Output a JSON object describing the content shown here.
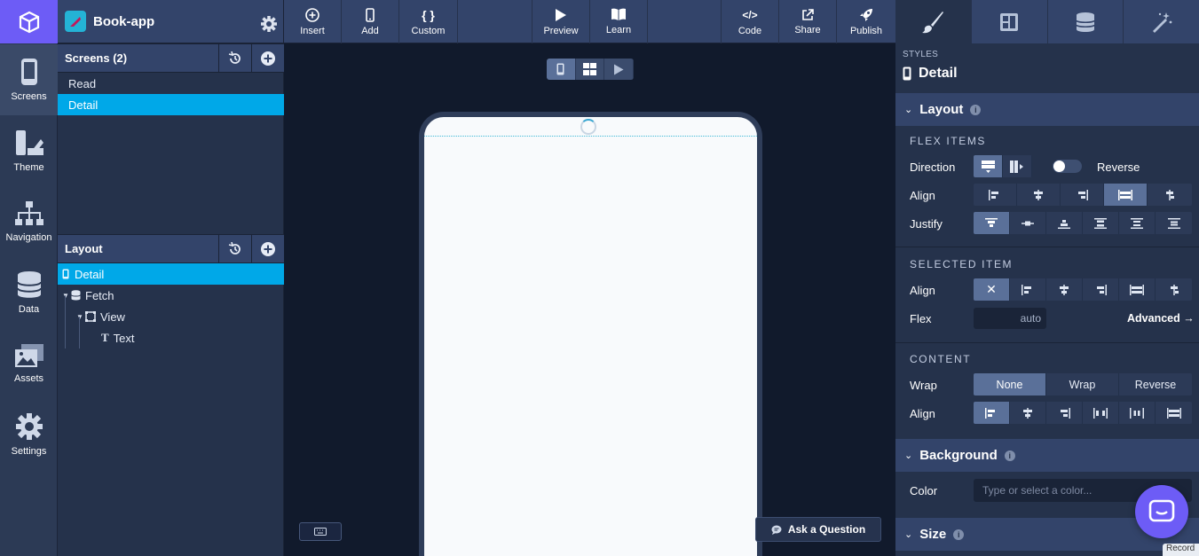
{
  "app": {
    "project_name": "Book-app",
    "brand_color": "#6d5cf6",
    "selection_color": "#00a8e8"
  },
  "rail": {
    "items": [
      {
        "label": "Screens",
        "icon": "phone-icon"
      },
      {
        "label": "Theme",
        "icon": "paint-icon"
      },
      {
        "label": "Navigation",
        "icon": "sitemap-icon"
      },
      {
        "label": "Data",
        "icon": "database-icon"
      },
      {
        "label": "Assets",
        "icon": "images-icon"
      },
      {
        "label": "Settings",
        "icon": "gear-icon"
      }
    ]
  },
  "screens": {
    "title": "Screens (2)",
    "items": [
      "Read",
      "Detail"
    ],
    "selected": "Detail"
  },
  "layout_tree": {
    "title": "Layout",
    "nodes": [
      {
        "label": "Detail",
        "icon": "phone-icon",
        "depth": 0
      },
      {
        "label": "Fetch",
        "icon": "database-icon",
        "depth": 1
      },
      {
        "label": "View",
        "icon": "square-icon",
        "depth": 2
      },
      {
        "label": "Text",
        "icon": "text-icon",
        "depth": 3
      }
    ]
  },
  "toolbar": {
    "insert": "Insert",
    "add": "Add",
    "custom": "Custom",
    "preview": "Preview",
    "learn": "Learn",
    "code": "Code",
    "share": "Share",
    "publish": "Publish"
  },
  "canvas": {
    "ask_label": "Ask a Question"
  },
  "styles": {
    "caption": "STYLES",
    "element": "Detail",
    "layout": {
      "title": "Layout",
      "flex_items": "FLEX ITEMS",
      "direction_label": "Direction",
      "reverse_label": "Reverse",
      "align_label": "Align",
      "justify_label": "Justify"
    },
    "selected_item": {
      "title": "SELECTED ITEM",
      "align_label": "Align",
      "flex_label": "Flex",
      "flex_value": "auto",
      "advanced": "Advanced →"
    },
    "content": {
      "title": "CONTENT",
      "wrap_label": "Wrap",
      "wrap_options": [
        "None",
        "Wrap",
        "Reverse"
      ],
      "wrap_selected": "None",
      "align_label": "Align"
    },
    "background": {
      "title": "Background",
      "color_label": "Color",
      "color_placeholder": "Type or select a color..."
    },
    "size": {
      "title": "Size"
    }
  },
  "chat": {
    "record_label": "Record"
  }
}
